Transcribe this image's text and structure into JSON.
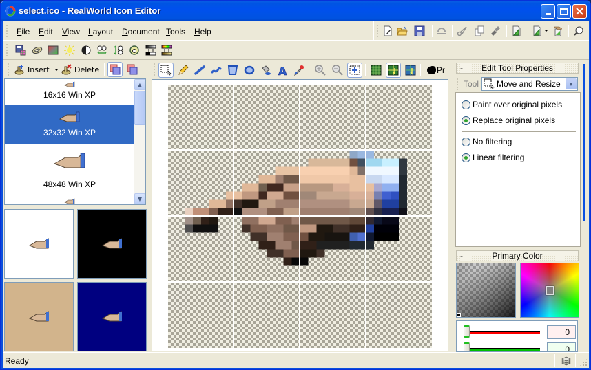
{
  "window": {
    "title": "select.ico - RealWorld Icon Editor",
    "controls": [
      "minimize",
      "maximize",
      "close"
    ]
  },
  "menu": {
    "items": [
      {
        "label": "File",
        "accel": "F"
      },
      {
        "label": "Edit",
        "accel": "E"
      },
      {
        "label": "View",
        "accel": "V"
      },
      {
        "label": "Layout",
        "accel": "L"
      },
      {
        "label": "Document",
        "accel": "D"
      },
      {
        "label": "Tools",
        "accel": "T"
      },
      {
        "label": "Help",
        "accel": "H"
      }
    ]
  },
  "main_toolbar": {
    "icons": [
      "new-icon",
      "open-folder-icon",
      "save-icon",
      "undo-icon",
      "cut-icon",
      "copy-icon",
      "paste-brush-icon",
      "create-image-icon",
      "create-dropdown-icon",
      "image-from-screen-icon",
      "help-bulb-icon"
    ]
  },
  "format_toolbar": {
    "icons": [
      "save-layer-icon",
      "ring-icon",
      "gradient-icon",
      "brightness-icon",
      "contrast-icon",
      "flip-horizontal-icon",
      "flip-vertical-icon",
      "rotate-icon",
      "grayscale-map-icon",
      "color-map-icon"
    ]
  },
  "left_panel": {
    "toolbar": {
      "insert_label": "Insert",
      "delete_label": "Delete"
    },
    "formats": [
      {
        "label": "16x16 Win XP",
        "selected": false
      },
      {
        "label": "32x32 Win XP",
        "selected": true
      },
      {
        "label": "48x48 Win XP",
        "selected": false
      }
    ],
    "previews": [
      {
        "background": "#ffffff"
      },
      {
        "background": "#000000"
      },
      {
        "background": "#d2b48c"
      },
      {
        "background": "#000080"
      }
    ]
  },
  "canvas_toolbar": {
    "tools": [
      "rect-select-tool",
      "pencil-tool",
      "line-tool",
      "curve-tool",
      "rectangle-tool",
      "ellipse-tool",
      "fill-tool",
      "text-tool",
      "eyedropper-tool",
      "zoom-in-tool",
      "zoom-out-tool",
      "fit-zoom-tool",
      "grid-tool",
      "grid-snap-tool",
      "grid-guide-tool",
      "brush-shape-tool"
    ],
    "overflow_label": "Pr"
  },
  "right_panel": {
    "edit_tool": {
      "header": "Edit Tool Properties",
      "collapse_label": "-",
      "tool_label": "Tool",
      "tool_value": "Move and Resize",
      "pixel_options": [
        {
          "label": "Paint over original pixels",
          "checked": false
        },
        {
          "label": "Replace original pixels",
          "checked": true
        }
      ],
      "filter_options": [
        {
          "label": "No filtering",
          "checked": false
        },
        {
          "label": "Linear filtering",
          "checked": true
        }
      ]
    },
    "primary_color": {
      "header": "Primary Color",
      "collapse_label": "-",
      "sliders": [
        {
          "channel": "red",
          "value": "0",
          "color": "#ff0000"
        },
        {
          "channel": "green",
          "value": "0",
          "color": "#00c000"
        }
      ]
    }
  },
  "status": {
    "text": "Ready"
  }
}
